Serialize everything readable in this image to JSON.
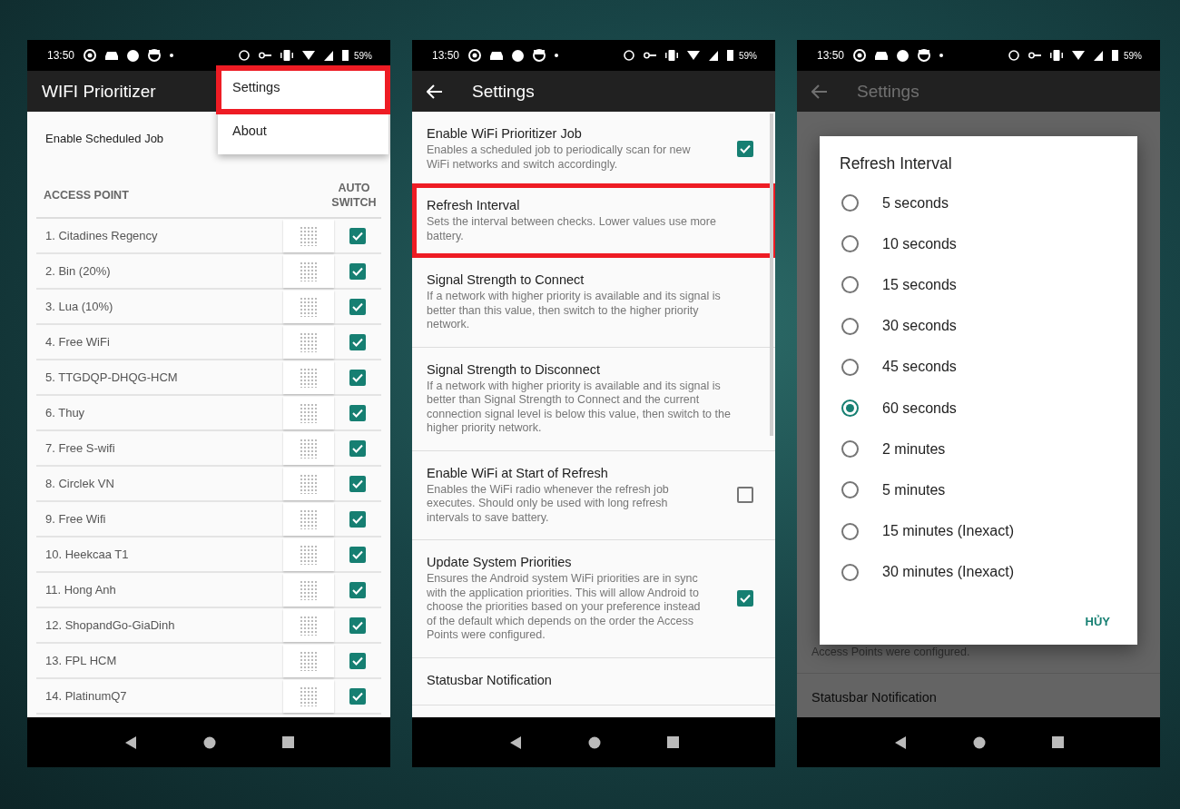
{
  "screens": [
    {
      "kind": "access_points",
      "status_bar": {
        "time": "13:50",
        "battery": "59%"
      },
      "app_bar": {
        "title": "WIFI Prioritizer"
      },
      "scheduled_job": {
        "label": "Enable Scheduled Job"
      },
      "columns": [
        "ACCESS POINT",
        "AUTO SWITCH"
      ],
      "rows": [
        {
          "name": "1. Citadines Regency",
          "auto_switch": true
        },
        {
          "name": "2. Bin (20%)",
          "auto_switch": true
        },
        {
          "name": "3. Lua (10%)",
          "auto_switch": true
        },
        {
          "name": "4. Free WiFi",
          "auto_switch": true
        },
        {
          "name": "5. TTGDQP-DHQG-HCM",
          "auto_switch": true
        },
        {
          "name": "6. Thuy",
          "auto_switch": true
        },
        {
          "name": "7. Free S-wifi",
          "auto_switch": true
        },
        {
          "name": "8. Circlek VN",
          "auto_switch": true
        },
        {
          "name": "9. Free Wifi",
          "auto_switch": true
        },
        {
          "name": "10. Heekcaa T1",
          "auto_switch": true
        },
        {
          "name": "11. Hong Anh",
          "auto_switch": true
        },
        {
          "name": "12. ShopandGo-GiaDinh",
          "auto_switch": true
        },
        {
          "name": "13. FPL HCM",
          "auto_switch": true
        },
        {
          "name": "14. PlatinumQ7",
          "auto_switch": true
        }
      ],
      "menu": {
        "items": [
          {
            "label": "Settings",
            "highlighted": true
          },
          {
            "label": "About",
            "highlighted": false
          }
        ]
      }
    },
    {
      "kind": "settings",
      "status_bar": {
        "time": "13:50",
        "battery": "59%"
      },
      "app_bar": {
        "title": "Settings"
      },
      "items": [
        {
          "kind": "checkbox",
          "title": "Enable WiFi Prioritizer Job",
          "summary": "Enables a scheduled job to periodically scan for new WiFi networks and switch accordingly.",
          "checked": true,
          "highlighted": false
        },
        {
          "kind": "plain",
          "title": "Refresh Interval",
          "summary": "Sets the interval between checks. Lower values use more battery.",
          "highlighted": true
        },
        {
          "kind": "plain",
          "title": "Signal Strength to Connect",
          "summary": "If a network with higher priority is available and its signal is better than this value, then switch to the higher priority network.",
          "highlighted": false
        },
        {
          "kind": "plain",
          "title": "Signal Strength to Disconnect",
          "summary": "If a network with higher priority is available and its signal is better than Signal Strength to Connect and the current connection signal level is below this value, then switch to the higher priority network.",
          "highlighted": false
        },
        {
          "kind": "checkbox",
          "title": "Enable WiFi at Start of Refresh",
          "summary": "Enables the WiFi radio whenever the refresh job executes. Should only be used with long refresh intervals to save battery.",
          "checked": false,
          "highlighted": false
        },
        {
          "kind": "checkbox",
          "title": "Update System Priorities",
          "summary": "Ensures the Android system WiFi priorities are in sync with the application priorities. This will allow Android to choose the priorities based on your preference instead of the default which depends on the order the Access Points were configured.",
          "checked": true,
          "highlighted": false
        },
        {
          "kind": "plain",
          "title": "Statusbar Notification",
          "highlighted": false
        }
      ]
    },
    {
      "kind": "dialog",
      "status_bar": {
        "time": "13:50",
        "battery": "59%"
      },
      "app_bar": {
        "title": "Settings"
      },
      "background_texts": [
        "Access Points were configured.",
        "Statusbar Notification"
      ],
      "dialog": {
        "title": "Refresh Interval",
        "options": [
          {
            "label": "5 seconds",
            "selected": false
          },
          {
            "label": "10 seconds",
            "selected": false
          },
          {
            "label": "15 seconds",
            "selected": false
          },
          {
            "label": "30 seconds",
            "selected": false
          },
          {
            "label": "45 seconds",
            "selected": false
          },
          {
            "label": "60 seconds",
            "selected": true
          },
          {
            "label": "2 minutes",
            "selected": false
          },
          {
            "label": "5 minutes",
            "selected": false
          },
          {
            "label": "15 minutes (Inexact)",
            "selected": false
          },
          {
            "label": "30 minutes (Inexact)",
            "selected": false
          }
        ],
        "button": "HỦY"
      }
    }
  ]
}
